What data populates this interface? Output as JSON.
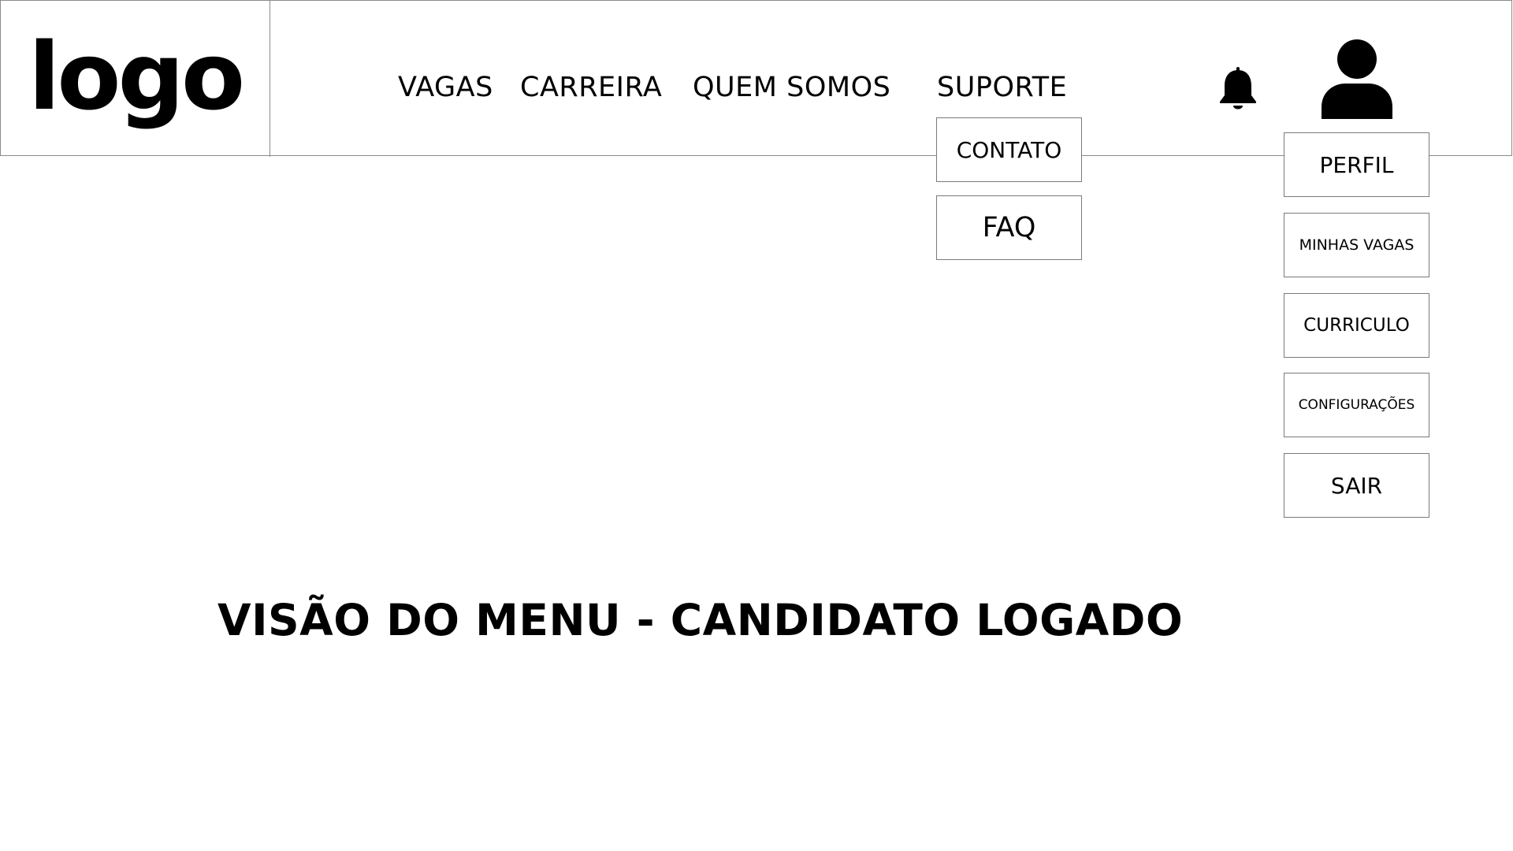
{
  "logo": {
    "text": "logo"
  },
  "nav": {
    "items": [
      {
        "label": "VAGAS"
      },
      {
        "label": "CARREIRA"
      },
      {
        "label": "QUEM SOMOS"
      },
      {
        "label": "SUPORTE"
      }
    ]
  },
  "support_menu": {
    "items": [
      {
        "label": "CONTATO"
      },
      {
        "label": "FAQ"
      }
    ]
  },
  "user_menu": {
    "items": [
      {
        "label": "PERFIL"
      },
      {
        "label": "MINHAS VAGAS"
      },
      {
        "label": "CURRICULO"
      },
      {
        "label": "CONFIGURAÇÕES"
      },
      {
        "label": "SAIR"
      }
    ]
  },
  "icons": {
    "notifications": "bell-icon",
    "user": "user-icon"
  },
  "caption": {
    "text": "VISÃO DO MENU - CANDIDATO LOGADO"
  },
  "colors": {
    "border": "#8a8a8a",
    "text": "#000000",
    "background": "#ffffff"
  }
}
